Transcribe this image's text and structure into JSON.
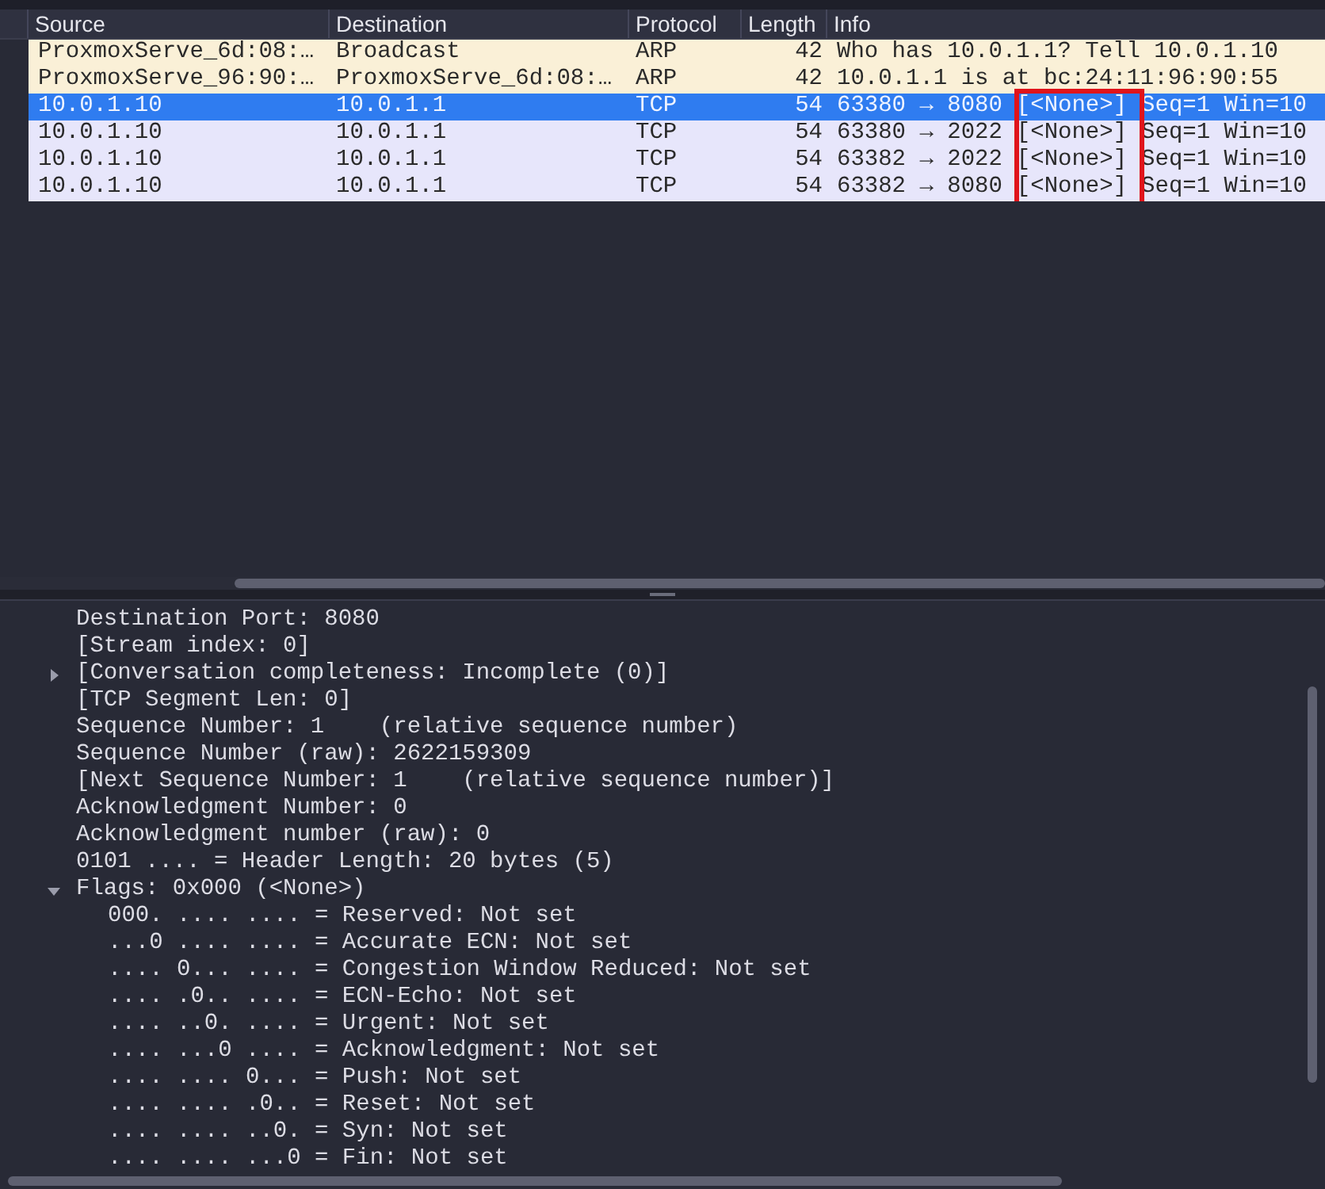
{
  "packet_list": {
    "columns": [
      "Source",
      "Destination",
      "Protocol",
      "Length",
      "Info"
    ],
    "rows": [
      {
        "source": "ProxmoxServe_6d:08:…",
        "destination": "Broadcast",
        "protocol": "ARP",
        "length": "42",
        "info": "Who has 10.0.1.1? Tell 10.0.1.10",
        "color": "#faf0d7",
        "selected": false,
        "highlighted": false
      },
      {
        "source": "ProxmoxServe_96:90:…",
        "destination": "ProxmoxServe_6d:08:…",
        "protocol": "ARP",
        "length": "42",
        "info": "10.0.1.1 is at bc:24:11:96:90:55",
        "color": "#faf0d7",
        "selected": false,
        "highlighted": false
      },
      {
        "source": "10.0.1.10",
        "destination": "10.0.1.1",
        "protocol": "TCP",
        "length": "54",
        "info": "63380 → 8080",
        "flags": "[<None>]",
        "info_rest": "Seq=1 Win=10",
        "selected": true,
        "highlighted": true
      },
      {
        "source": "10.0.1.10",
        "destination": "10.0.1.1",
        "protocol": "TCP",
        "length": "54",
        "info": "63380 → 2022",
        "flags": "[<None>]",
        "info_rest": "Seq=1 Win=10",
        "color": "#e7e6fb",
        "selected": false,
        "highlighted": true
      },
      {
        "source": "10.0.1.10",
        "destination": "10.0.1.1",
        "protocol": "TCP",
        "length": "54",
        "info": "63382 → 2022",
        "flags": "[<None>]",
        "info_rest": "Seq=1 Win=10",
        "color": "#e7e6fb",
        "selected": false,
        "highlighted": true
      },
      {
        "source": "10.0.1.10",
        "destination": "10.0.1.1",
        "protocol": "TCP",
        "length": "54",
        "info": "63382 → 8080",
        "flags": "[<None>]",
        "info_rest": "Seq=1 Win=10",
        "color": "#e7e6fb",
        "selected": false,
        "highlighted": true
      }
    ]
  },
  "packet_details": [
    {
      "text": "Destination Port: 8080"
    },
    {
      "text": "[Stream index: 0]"
    },
    {
      "text": "[Conversation completeness: Incomplete (0)]",
      "expanded": false
    },
    {
      "text": "[TCP Segment Len: 0]"
    },
    {
      "text": "Sequence Number: 1    (relative sequence number)"
    },
    {
      "text": "Sequence Number (raw): 2622159309"
    },
    {
      "text": "[Next Sequence Number: 1    (relative sequence number)]"
    },
    {
      "text": "Acknowledgment Number: 0"
    },
    {
      "text": "Acknowledgment number (raw): 0"
    },
    {
      "text": "0101 .... = Header Length: 20 bytes (5)"
    },
    {
      "text": "Flags: 0x000 (<None>)",
      "expanded": true,
      "children": [
        {
          "text": "000. .... .... = Reserved: Not set"
        },
        {
          "text": "...0 .... .... = Accurate ECN: Not set"
        },
        {
          "text": ".... 0... .... = Congestion Window Reduced: Not set"
        },
        {
          "text": ".... .0.. .... = ECN-Echo: Not set"
        },
        {
          "text": ".... ..0. .... = Urgent: Not set"
        },
        {
          "text": ".... ...0 .... = Acknowledgment: Not set"
        },
        {
          "text": ".... .... 0... = Push: Not set"
        },
        {
          "text": ".... .... .0.. = Reset: Not set"
        },
        {
          "text": ".... .... ..0. = Syn: Not set"
        },
        {
          "text": ".... .... ...0 = Fin: Not set"
        }
      ]
    }
  ]
}
